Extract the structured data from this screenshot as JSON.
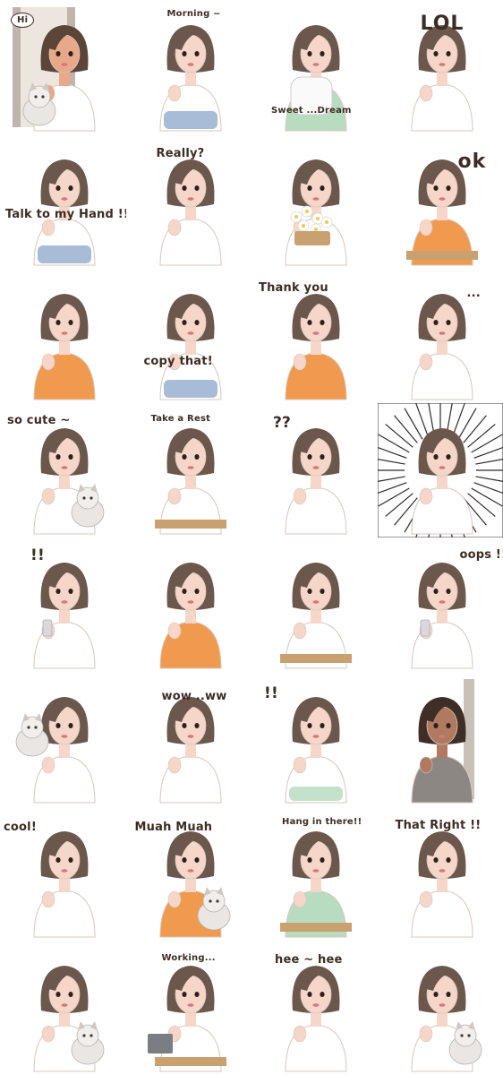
{
  "stickers": [
    {
      "caption": "Hi",
      "top": "white",
      "skin": "#e7a98a",
      "hair": "#5b4538",
      "extra": "door-cat"
    },
    {
      "caption": "Morning ~",
      "top": "white",
      "skin": "#f5d6c8",
      "hair": "#6b574c",
      "extra": "jeans"
    },
    {
      "caption": "Sweet ...Dream",
      "top": "green",
      "skin": "#f5d6c8",
      "hair": "#6b574c",
      "extra": "pillow"
    },
    {
      "caption": "LOL",
      "top": "white",
      "skin": "#f5d6c8",
      "hair": "#6b574c",
      "extra": "none"
    },
    {
      "caption": "Talk to my Hand !!",
      "top": "white",
      "skin": "#f5d6c8",
      "hair": "#6b574c",
      "extra": "shorts"
    },
    {
      "caption": "Really?",
      "top": "white",
      "skin": "#f5d6c8",
      "hair": "#6b574c",
      "extra": "none"
    },
    {
      "caption": "",
      "top": "white",
      "skin": "#f5d6c8",
      "hair": "#6b574c",
      "extra": "flowers"
    },
    {
      "caption": "ok",
      "top": "orange",
      "skin": "#f5d6c8",
      "hair": "#6b574c",
      "extra": "stool"
    },
    {
      "caption": "",
      "top": "orange",
      "skin": "#f5d6c8",
      "hair": "#6b574c",
      "extra": "none"
    },
    {
      "caption": "copy that!",
      "top": "white",
      "skin": "#f5d6c8",
      "hair": "#6b574c",
      "extra": "shorts"
    },
    {
      "caption": "Thank you",
      "top": "orange",
      "skin": "#f5d6c8",
      "hair": "#6b574c",
      "extra": "sitting"
    },
    {
      "caption": "...",
      "top": "white",
      "skin": "#f5d6c8",
      "hair": "#6b574c",
      "extra": "none"
    },
    {
      "caption": "so cute ~",
      "top": "white",
      "skin": "#f5d6c8",
      "hair": "#6b574c",
      "extra": "cat"
    },
    {
      "caption": "Take a Rest",
      "top": "white",
      "skin": "#f5d6c8",
      "hair": "#6b574c",
      "extra": "chair"
    },
    {
      "caption": "??",
      "top": "white",
      "skin": "#f5d6c8",
      "hair": "#6b574c",
      "extra": "none"
    },
    {
      "caption": "",
      "top": "white",
      "skin": "#f5d6c8",
      "hair": "#6b574c",
      "extra": "rays"
    },
    {
      "caption": "!!",
      "top": "white",
      "skin": "#f5d6c8",
      "hair": "#6b574c",
      "extra": "phone"
    },
    {
      "caption": "",
      "top": "orange",
      "skin": "#f5d6c8",
      "hair": "#6b574c",
      "extra": "none"
    },
    {
      "caption": "",
      "top": "white",
      "skin": "#f5d6c8",
      "hair": "#6b574c",
      "extra": "table"
    },
    {
      "caption": "oops !!",
      "top": "white",
      "skin": "#f5d6c8",
      "hair": "#6b574c",
      "extra": "phone"
    },
    {
      "caption": "",
      "top": "white",
      "skin": "#f5d6c8",
      "hair": "#6b574c",
      "extra": "cat-top"
    },
    {
      "caption": "wow ..ww",
      "top": "white",
      "skin": "#f5d6c8",
      "hair": "#6b574c",
      "extra": "none"
    },
    {
      "caption": "!!",
      "top": "white",
      "skin": "#f5d6c8",
      "hair": "#6b574c",
      "extra": "greenpants"
    },
    {
      "caption": "",
      "top": "grey",
      "skin": "#b07a60",
      "hair": "#3f2e26",
      "extra": "door"
    },
    {
      "caption": "cool!",
      "top": "white",
      "skin": "#f5d6c8",
      "hair": "#6b574c",
      "extra": "none"
    },
    {
      "caption": "Muah Muah",
      "top": "orange",
      "skin": "#f5d6c8",
      "hair": "#6b574c",
      "extra": "cat"
    },
    {
      "caption": "Hang in there!!",
      "top": "green",
      "skin": "#f5d6c8",
      "hair": "#6b574c",
      "extra": "chair"
    },
    {
      "caption": "That Right !!",
      "top": "white",
      "skin": "#f5d6c8",
      "hair": "#6b574c",
      "extra": "none"
    },
    {
      "caption": "",
      "top": "white",
      "skin": "#f5d6c8",
      "hair": "#6b574c",
      "extra": "cat"
    },
    {
      "caption": "Working...",
      "top": "white",
      "skin": "#f5d6c8",
      "hair": "#6b574c",
      "extra": "laptop"
    },
    {
      "caption": "hee ~ hee",
      "top": "white",
      "skin": "#f5d6c8",
      "hair": "#6b574c",
      "extra": "none"
    },
    {
      "caption": "",
      "top": "white",
      "skin": "#f5d6c8",
      "hair": "#6b574c",
      "extra": "cat"
    }
  ],
  "colors": {
    "white": "#ffffff",
    "orange": "#ef9a4e",
    "green": "#b8dcc0",
    "grey": "#8c8783",
    "outline": "#d8c7bd",
    "lips": "#d9757a",
    "text": "#3d2c24",
    "denim": "#a8bcd8",
    "wood": "#c9a170"
  }
}
